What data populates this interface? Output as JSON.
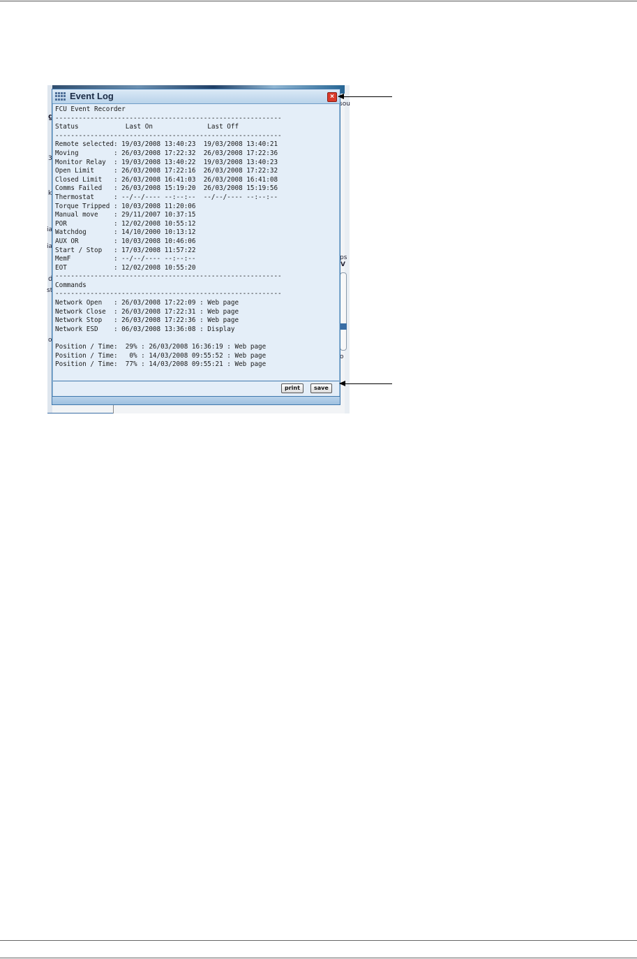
{
  "window": {
    "title": "Event Log",
    "close_symbol": "×"
  },
  "log_lines": [
    "FCU Event Recorder",
    "----------------------------------------------------------",
    "Status            Last On              Last Off",
    "----------------------------------------------------------",
    "Remote selected: 19/03/2008 13:40:23  19/03/2008 13:40:21",
    "Moving         : 26/03/2008 17:22:32  26/03/2008 17:22:36",
    "Monitor Relay  : 19/03/2008 13:40:22  19/03/2008 13:40:23",
    "Open Limit     : 26/03/2008 17:22:16  26/03/2008 17:22:32",
    "Closed Limit   : 26/03/2008 16:41:03  26/03/2008 16:41:08",
    "Comms Failed   : 26/03/2008 15:19:20  26/03/2008 15:19:56",
    "Thermostat     : --/--/---- --:--:--  --/--/---- --:--:--",
    "Torque Tripped : 10/03/2008 11:20:06",
    "Manual move    : 29/11/2007 10:37:15",
    "POR            : 12/02/2008 10:55:12",
    "Watchdog       : 14/10/2000 10:13:12",
    "AUX OR         : 10/03/2008 10:46:06",
    "Start / Stop   : 17/03/2008 11:57:22",
    "MemF           : --/--/---- --:--:--",
    "EOT            : 12/02/2008 10:55:20",
    "----------------------------------------------------------",
    "Commands",
    "----------------------------------------------------------",
    "Network Open   : 26/03/2008 17:22:09 : Web page",
    "Network Close  : 26/03/2008 17:22:31 : Web page",
    "Network Stop   : 26/03/2008 17:22:36 : Web page",
    "Network ESD    : 06/03/2008 13:36:08 : Display",
    "",
    "Position / Time:  29% : 26/03/2008 16:36:19 : Web page",
    "Position / Time:   0% : 14/03/2008 09:55:52 : Web page",
    "Position / Time:  77% : 14/03/2008 09:55:21 : Web page"
  ],
  "buttons": {
    "print": "print",
    "save": "save"
  },
  "background_fragments": [
    "sou",
    "g",
    "3",
    "k",
    "ia",
    "ia",
    "d",
    "st",
    "o",
    "ps",
    "V",
    "o"
  ]
}
